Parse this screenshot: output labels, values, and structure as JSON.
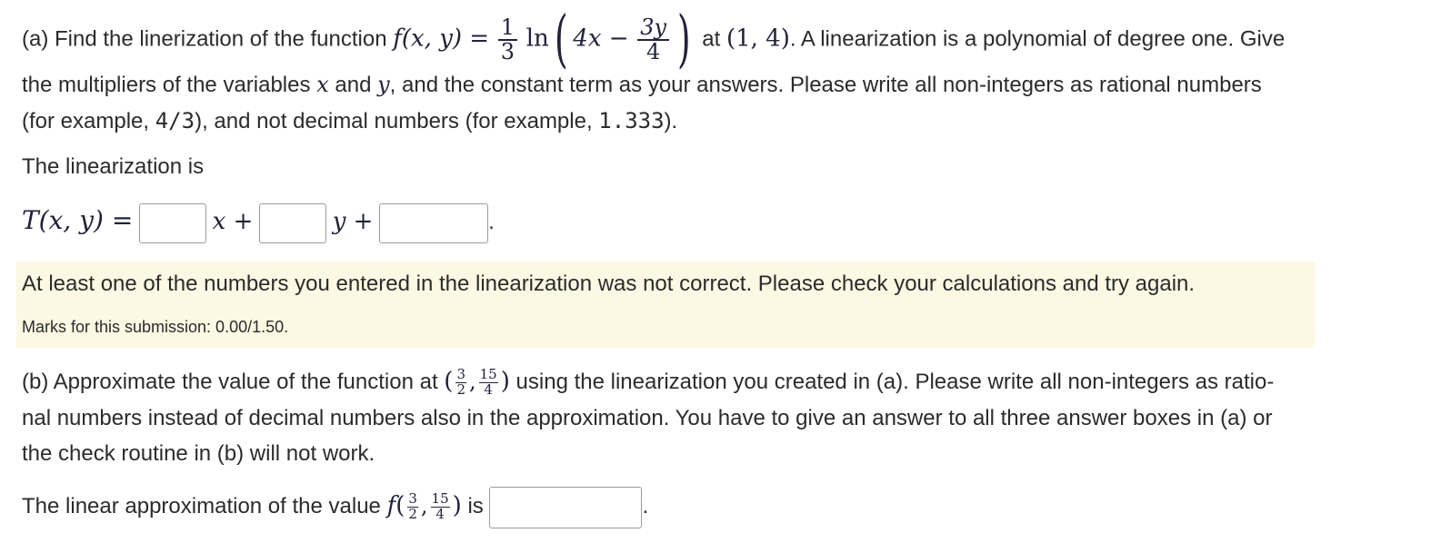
{
  "partA": {
    "intro": "(a) Find the linerization of the function",
    "func_lhs": "f(x, y) =",
    "coef_num": "1",
    "coef_den": "3",
    "ln": "ln",
    "inner_a": "4x −",
    "inner_num": "3y",
    "inner_den": "4",
    "at": "at",
    "point": "(1, 4)",
    "after_point": ". A linearization is a polynomial of degree one. Give",
    "line2_a": "the multipliers of the variables",
    "var_x": "x",
    "and": "and",
    "var_y": "y",
    "line2_b": ", and the constant term as your answers. Please write all non-integers as rational numbers",
    "line3_a": "(for example,",
    "example_rational": "4/3",
    "line3_b": "), and not decimal numbers (for example,",
    "example_decimal": "1.333",
    "line3_c": ").",
    "linearization_label": "The linearization is",
    "T_lhs": "T(x, y) =",
    "x_plus": "x +",
    "y_plus": "y +",
    "period": ".",
    "inputs": {
      "x_coef": "",
      "y_coef": "",
      "constant": ""
    }
  },
  "feedback": {
    "message": "At least one of the numbers you entered in the linearization was not correct. Please check your calculations and try again.",
    "marks": "Marks for this submission: 0.00/1.50."
  },
  "partB": {
    "line1_a": "(b) Approximate the value of the function at",
    "pt_x_num": "3",
    "pt_x_den": "2",
    "pt_y_num": "15",
    "pt_y_den": "4",
    "line1_b": "using the linearization you created in (a). Please write all non-integers as ratio-",
    "line2": "nal numbers instead of decimal numbers also in the approximation. You have to give an answer to all three answer boxes in (a) or",
    "line3": "the check routine in (b) will not work.",
    "approx_a": "The linear approximation of the value",
    "f": "f",
    "is": "is",
    "period": ".",
    "input": ""
  },
  "colors": {
    "feedback_bg": "#fcf8e3",
    "text": "#2b2b2b",
    "math": "#22223a",
    "box_border": "#9a9a9a"
  }
}
